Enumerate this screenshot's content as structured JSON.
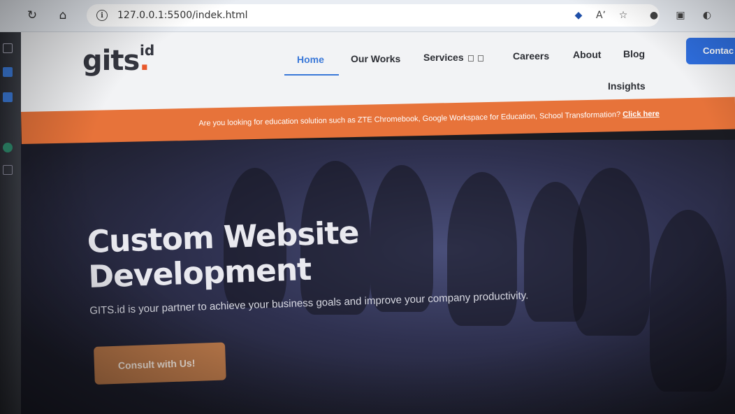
{
  "browser": {
    "url": "127.0.0.1:5500/indek.html",
    "icons": [
      "reload-icon",
      "home-icon",
      "info-icon",
      "bookmark-tag-icon",
      "read-aloud-icon",
      "favorites-icon",
      "extension-icon",
      "collections-icon",
      "profile-icon"
    ]
  },
  "header": {
    "logo_main": "gits",
    "logo_sup": "id",
    "nav": {
      "home": "Home",
      "our_works": "Our Works",
      "services": "Services",
      "careers": "Careers",
      "about": "About",
      "blog": "Blog",
      "insights": "Insights"
    },
    "contact_label": "Contac"
  },
  "promo": {
    "text": "Are you looking for education solution such as ZTE Chromebook, Google Workspace for Education, School Transformation?",
    "link": "Click here"
  },
  "hero": {
    "title_line1": "Custom Website",
    "title_line2": "Development",
    "subtitle": "GITS.id is your partner to achieve your business goals and improve your company productivity.",
    "cta_label": "Consult with Us!"
  },
  "colors": {
    "brand_orange": "#e7733a",
    "nav_active": "#3a78d8",
    "contact_button": "#2f6fe0",
    "cta_button": "#b9784a"
  }
}
